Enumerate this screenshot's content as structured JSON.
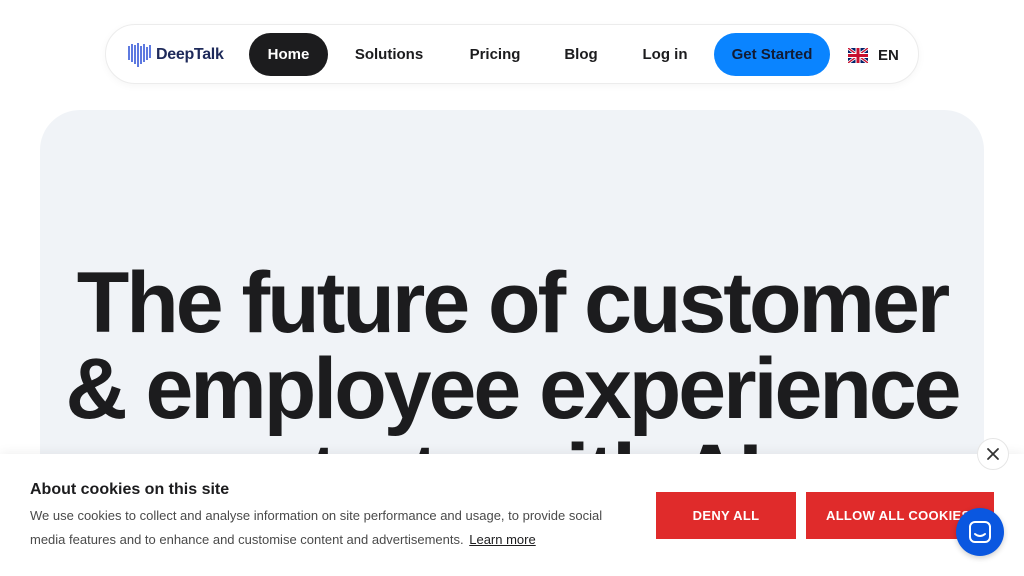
{
  "nav": {
    "logo_text": "DeepTalk",
    "items": [
      {
        "label": "Home"
      },
      {
        "label": "Solutions"
      },
      {
        "label": "Pricing"
      },
      {
        "label": "Blog"
      },
      {
        "label": "Log in"
      }
    ],
    "cta_label": "Get Started",
    "language": "EN",
    "language_icon": "uk-flag-icon"
  },
  "hero": {
    "headline_line1": "The future of customer",
    "headline_line2": "& employee experience",
    "headline_line3": "starts with AI"
  },
  "cookie_banner": {
    "title": "About cookies on this site",
    "text": "We use cookies to collect and analyse information on site performance and usage, to provide social media features and to enhance and customise content and advertisements.",
    "learn_more": "Learn more",
    "deny_label": "DENY ALL",
    "allow_label": "ALLOW ALL COOKIES",
    "close_icon": "close-icon"
  },
  "chat_widget": {
    "icon": "chat-icon"
  },
  "colors": {
    "primary": "#0a84ff",
    "dark": "#1c1c1e",
    "cookie_buttons": "#e02b2b",
    "hero_bg": "#f0f3f7",
    "chat": "#0a57e0"
  }
}
